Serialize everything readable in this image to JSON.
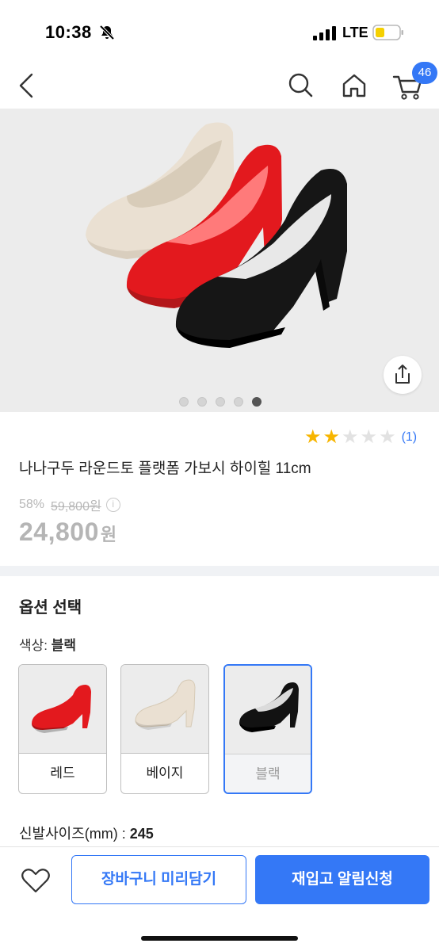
{
  "status_bar": {
    "time": "10:38",
    "network": "LTE"
  },
  "header": {
    "cart_count": "46"
  },
  "hero": {
    "page_count": 5,
    "active_page": 5
  },
  "product": {
    "rating": 2,
    "rating_max": 5,
    "review_count": "(1)",
    "title": "나나구두 라운드토 플랫폼 가보시 하이힐 11cm",
    "discount": "58%",
    "original_price": "59,800원",
    "sale_price": "24,800",
    "sale_currency": "원"
  },
  "options": {
    "heading": "옵션 선택",
    "color_label": "색상: ",
    "selected_color": "블랙",
    "colors": [
      {
        "label": "레드",
        "shoe_color": "#e3191e",
        "selected": false
      },
      {
        "label": "베이지",
        "shoe_color": "#eae0d2",
        "selected": false
      },
      {
        "label": "블랙",
        "shoe_color": "#121212",
        "selected": true
      }
    ],
    "size_label": "신발사이즈(mm) : ",
    "selected_size": "245"
  },
  "actions": {
    "cart_label": "장바구니 미리담기",
    "restock_label": "재입고 알림신청"
  },
  "colors": {
    "accent": "#3478f6",
    "star": "#f7b500",
    "battery": "#f5d000"
  }
}
